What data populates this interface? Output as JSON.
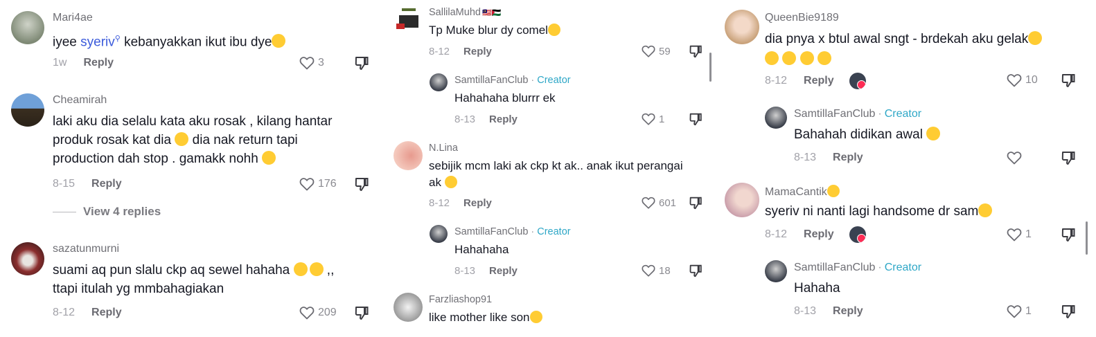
{
  "col1": {
    "c1": {
      "user": "Mari4ae",
      "text_pre": "iyee ",
      "mention": "syeriv",
      "text_post": " kebanyakkan ikut ibu dye",
      "date": "1w",
      "reply": "Reply",
      "likes": "3"
    },
    "c2": {
      "user": "Cheamirah",
      "l1": "laki aku dia selalu kata aku rosak , kilang hantar",
      "l2a": "produk rosak kat dia ",
      "l2b": " dia nak return tapi",
      "l3": "production dah stop . gamakk nohh ",
      "date": "8-15",
      "reply": "Reply",
      "likes": "176",
      "view_replies": "View 4 replies"
    },
    "c3": {
      "user": "sazatunmurni",
      "l1a": "suami aq pun slalu ckp aq sewel hahaha ",
      "l1b": " ,,",
      "l2": "ttapi itulah yg mmbahagiakan",
      "date": "8-12",
      "reply": "Reply",
      "likes": "209"
    }
  },
  "col2": {
    "c1": {
      "user": "SallilaMuhd",
      "flags": "🇲🇾🇵🇸",
      "text": "Tp Muke blur dy comel",
      "date": "8-12",
      "reply": "Reply",
      "likes": "59"
    },
    "r1": {
      "user": "SamtillaFanClub",
      "dot": "·",
      "creator": "Creator",
      "text": "Hahahaha blurrr ek",
      "date": "8-13",
      "reply": "Reply",
      "likes": "1"
    },
    "c2": {
      "user": "N.Lina",
      "l1": "sebijik mcm laki ak ckp kt ak.. anak ikut perangai",
      "l2": "ak ",
      "date": "8-12",
      "reply": "Reply",
      "likes": "601"
    },
    "r2": {
      "user": "SamtillaFanClub",
      "dot": "·",
      "creator": "Creator",
      "text": "Hahahaha",
      "date": "8-13",
      "reply": "Reply",
      "likes": "18"
    },
    "c3": {
      "user": "Farzliashop91",
      "text": "like mother like son"
    }
  },
  "col3": {
    "c1": {
      "user": "QueenBie9189",
      "l1": "dia pnya x btul awal sngt - brdekah aku gelak",
      "date": "8-12",
      "reply": "Reply",
      "likes": "10"
    },
    "r1": {
      "user": "SamtillaFanClub",
      "dot": "·",
      "creator": "Creator",
      "text": "Bahahah didikan awal ",
      "date": "8-13",
      "reply": "Reply",
      "likes": ""
    },
    "c2": {
      "user": "MamaCantik",
      "text": "syeriv ni nanti lagi handsome dr sam",
      "date": "8-12",
      "reply": "Reply",
      "likes": "1"
    },
    "r2": {
      "user": "SamtillaFanClub",
      "dot": "·",
      "creator": "Creator",
      "text": "Hahaha",
      "date": "8-13",
      "reply": "Reply",
      "likes": "1"
    }
  }
}
